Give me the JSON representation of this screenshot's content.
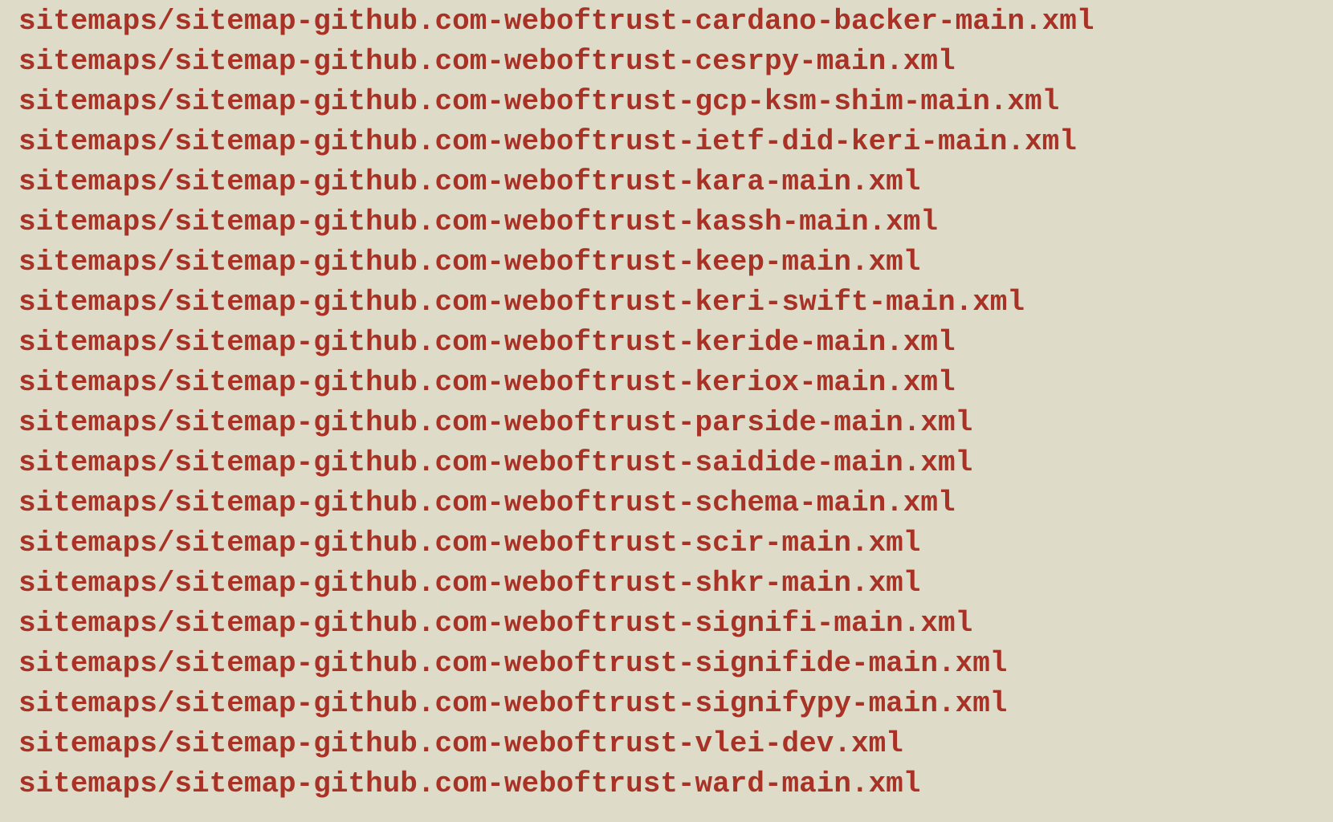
{
  "colors": {
    "background": "#dedbc8",
    "link_text": "#a93226"
  },
  "files": [
    "sitemaps/sitemap-github.com-weboftrust-cardano-backer-main.xml",
    "sitemaps/sitemap-github.com-weboftrust-cesrpy-main.xml",
    "sitemaps/sitemap-github.com-weboftrust-gcp-ksm-shim-main.xml",
    "sitemaps/sitemap-github.com-weboftrust-ietf-did-keri-main.xml",
    "sitemaps/sitemap-github.com-weboftrust-kara-main.xml",
    "sitemaps/sitemap-github.com-weboftrust-kassh-main.xml",
    "sitemaps/sitemap-github.com-weboftrust-keep-main.xml",
    "sitemaps/sitemap-github.com-weboftrust-keri-swift-main.xml",
    "sitemaps/sitemap-github.com-weboftrust-keride-main.xml",
    "sitemaps/sitemap-github.com-weboftrust-keriox-main.xml",
    "sitemaps/sitemap-github.com-weboftrust-parside-main.xml",
    "sitemaps/sitemap-github.com-weboftrust-saidide-main.xml",
    "sitemaps/sitemap-github.com-weboftrust-schema-main.xml",
    "sitemaps/sitemap-github.com-weboftrust-scir-main.xml",
    "sitemaps/sitemap-github.com-weboftrust-shkr-main.xml",
    "sitemaps/sitemap-github.com-weboftrust-signifi-main.xml",
    "sitemaps/sitemap-github.com-weboftrust-signifide-main.xml",
    "sitemaps/sitemap-github.com-weboftrust-signifypy-main.xml",
    "sitemaps/sitemap-github.com-weboftrust-vlei-dev.xml",
    "sitemaps/sitemap-github.com-weboftrust-ward-main.xml"
  ]
}
